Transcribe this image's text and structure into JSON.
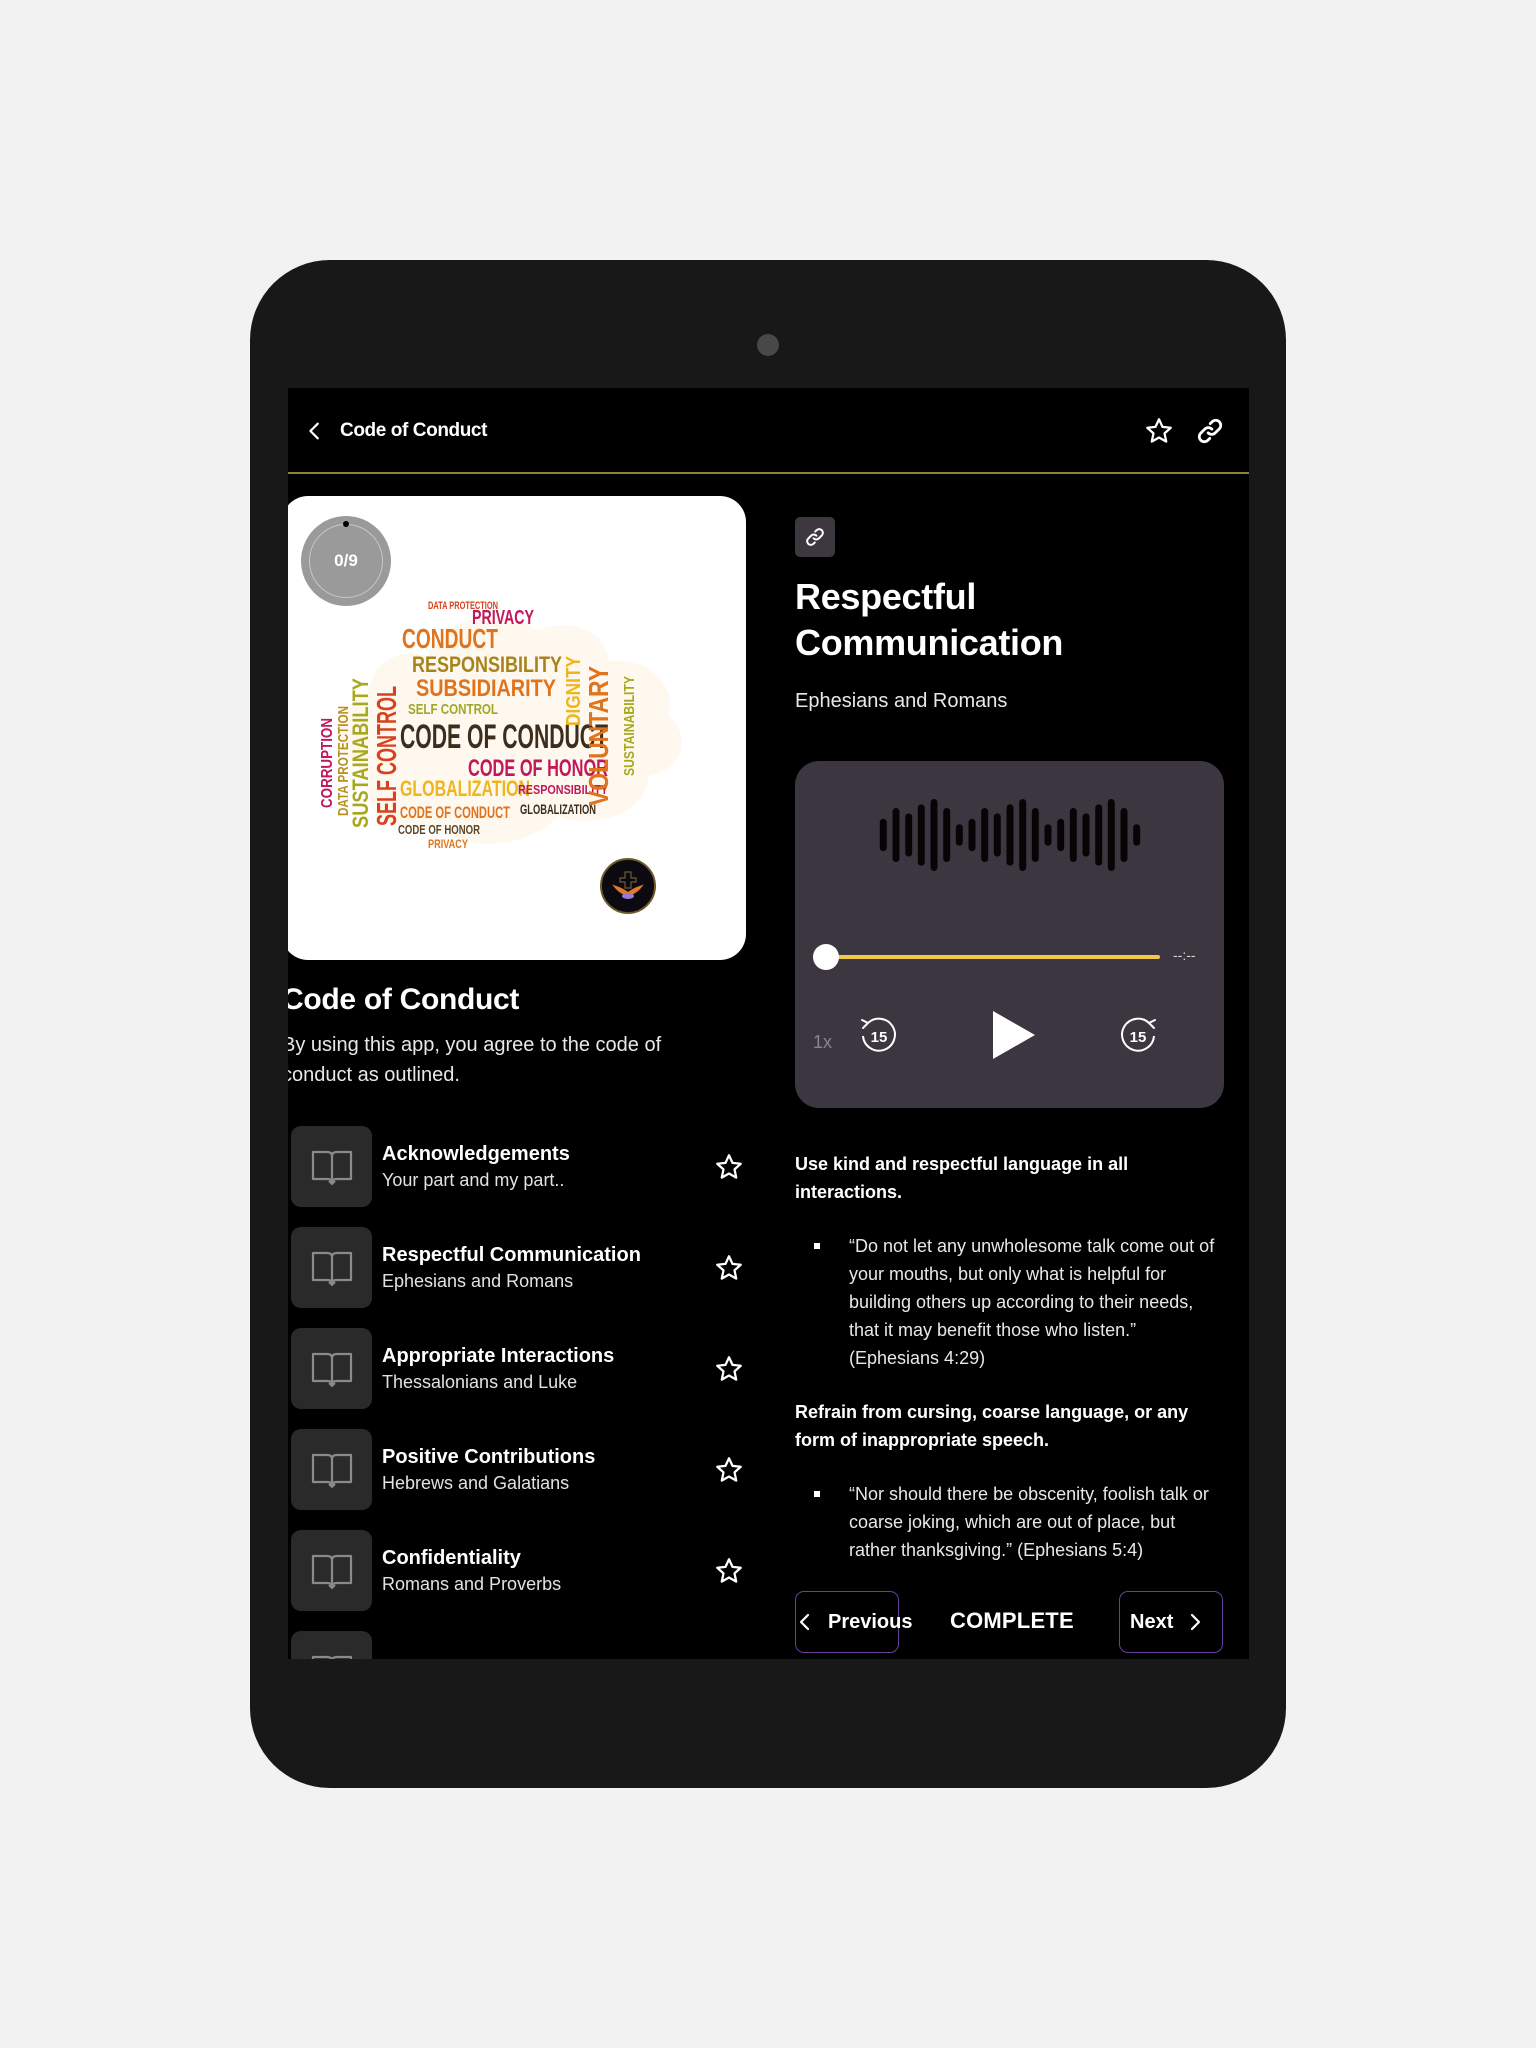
{
  "header": {
    "back_label": "Code of Conduct",
    "icons": [
      "chevron-left-icon",
      "star-icon",
      "link-icon"
    ]
  },
  "course": {
    "progress_text": "0/9",
    "progress": {
      "completed": 0,
      "total": 9
    },
    "cover_words": [
      "CODE OF CONDUCT",
      "CODE OF HONOR",
      "CONDUCT",
      "RESPONSIBILITY",
      "SUBSIDIARITY",
      "SELF CONTROL",
      "GLOBALIZATION",
      "SUSTAINABILITY",
      "VOLUNTARY",
      "DIGNITY",
      "PRIVACY",
      "DATA PROTECTION",
      "CORRUPTION"
    ],
    "title": "Code of Conduct",
    "description": "By using this app, you agree to the code of conduct as outlined."
  },
  "lessons": [
    {
      "title": "Acknowledgements",
      "subtitle": "Your part and my part.."
    },
    {
      "title": "Respectful Communication",
      "subtitle": "Ephesians and Romans"
    },
    {
      "title": "Appropriate Interactions",
      "subtitle": "Thessalonians and Luke"
    },
    {
      "title": "Positive Contributions",
      "subtitle": "Hebrews and Galatians"
    },
    {
      "title": "Confidentiality",
      "subtitle": "Romans and Proverbs"
    },
    {
      "title": "",
      "subtitle": ""
    }
  ],
  "detail": {
    "title": "Respectful Communication",
    "subtitle": "Ephesians and Romans",
    "player": {
      "time_remaining": "--:--",
      "speed": "1x",
      "rewind_seconds": "15",
      "forward_seconds": "15",
      "position": 0,
      "waveform_levels": [
        0.45,
        0.75,
        0.6,
        0.85,
        1.0,
        0.75,
        0.3,
        0.45,
        0.75,
        0.6,
        0.85,
        1.0,
        0.75,
        0.3,
        0.45,
        0.75,
        0.6,
        0.85,
        1.0,
        0.75,
        0.3
      ]
    },
    "sections": [
      {
        "heading": "Use kind and respectful language in all interactions.",
        "quote": "“Do not let any unwholesome talk come out of your mouths, but only what is helpful for building others up according to their needs, that it may benefit those who listen.” (Ephesians 4:29)"
      },
      {
        "heading": "Refrain from cursing, coarse language, or any form of inappropriate speech.",
        "quote": "“Nor should there be obscenity, foolish talk or coarse joking, which are out of place, but rather thanksgiving.” (Ephesians 5:4)"
      }
    ]
  },
  "footer": {
    "previous_label": "Previous",
    "complete_label": "COMPLETE",
    "next_label": "Next"
  },
  "colors": {
    "accent_gold": "#f0c94a",
    "header_rule": "#8f7f3f",
    "nav_border": "#6a3f9a",
    "player_bg": "#3c3640",
    "tile_bg": "#2a2a2a"
  }
}
